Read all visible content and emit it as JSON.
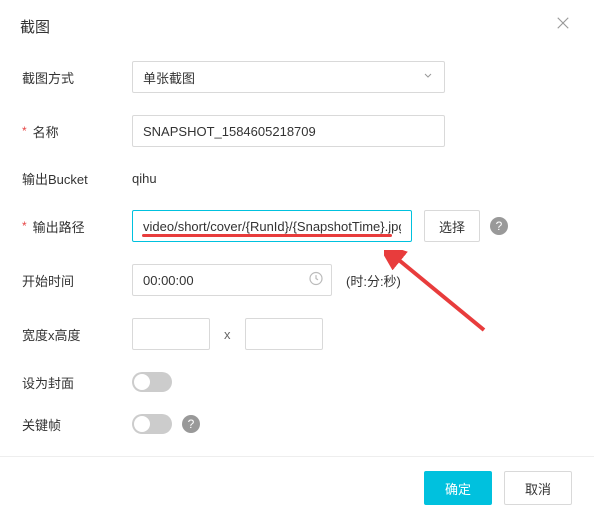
{
  "dialog": {
    "title": "截图",
    "labels": {
      "mode": "截图方式",
      "name": "名称",
      "bucket": "输出Bucket",
      "path": "输出路径",
      "start": "开始时间",
      "size": "宽度x高度",
      "cover": "设为封面",
      "keyframe": "关键帧"
    },
    "mode_value": "单张截图",
    "name_value": "SNAPSHOT_1584605218709",
    "bucket_value": "qihu",
    "path_value": "video/short/cover/{RunId}/{SnapshotTime}.jpg",
    "select_btn": "选择",
    "start_value": "00:00:00",
    "start_hint": "(时:分:秒)",
    "width_value": "",
    "height_value": "",
    "size_sep": "x",
    "help_glyph": "?"
  },
  "footer": {
    "ok": "确定",
    "cancel": "取消"
  }
}
